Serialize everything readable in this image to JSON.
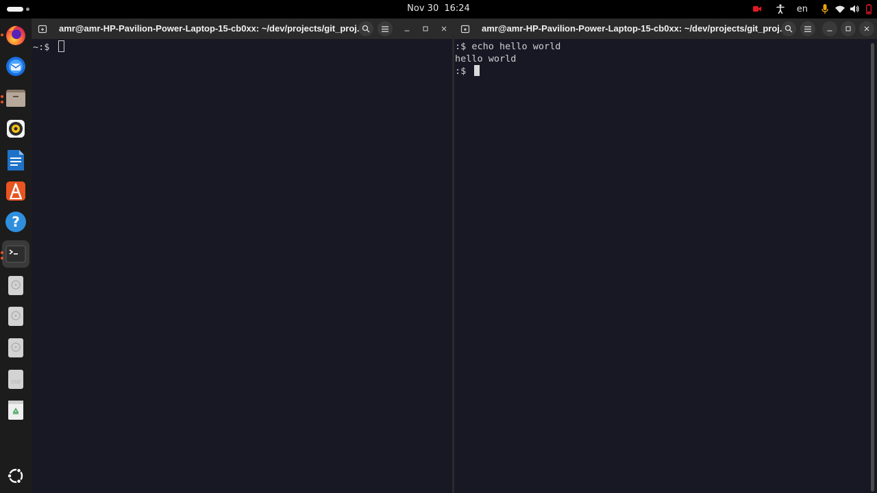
{
  "topbar": {
    "date": "Nov 30",
    "time": "16:24",
    "language": "en"
  },
  "dock": {
    "items": [
      {
        "name": "firefox-icon"
      },
      {
        "name": "thunderbird-icon"
      },
      {
        "name": "files-icon"
      },
      {
        "name": "rhythmbox-icon"
      },
      {
        "name": "libreoffice-writer-icon"
      },
      {
        "name": "app-center-icon"
      },
      {
        "name": "help-icon"
      },
      {
        "name": "terminal-icon"
      },
      {
        "name": "disk-drive-icon"
      },
      {
        "name": "disk-drive-icon"
      },
      {
        "name": "disk-drive-icon"
      },
      {
        "name": "ssd-drive-icon",
        "label": "SSD"
      },
      {
        "name": "trash-icon"
      },
      {
        "name": "show-apps-icon"
      }
    ]
  },
  "terminals": {
    "left": {
      "title": "amr@amr-HP-Pavilion-Power-Laptop-15-cb0xx: ~/dev/projects/git_proj...",
      "lines": [
        "~:$ "
      ]
    },
    "right": {
      "title": "amr@amr-HP-Pavilion-Power-Laptop-15-cb0xx: ~/dev/projects/git_proj...",
      "lines": [
        ":$ echo hello world",
        "hello world",
        ":$ "
      ]
    }
  },
  "colors": {
    "terminal_bg": "#181825",
    "titlebar_bg": "#2b2b2b",
    "accent": "#e95420",
    "mic_active": "#e5a50a",
    "record_red": "#e01b24"
  }
}
